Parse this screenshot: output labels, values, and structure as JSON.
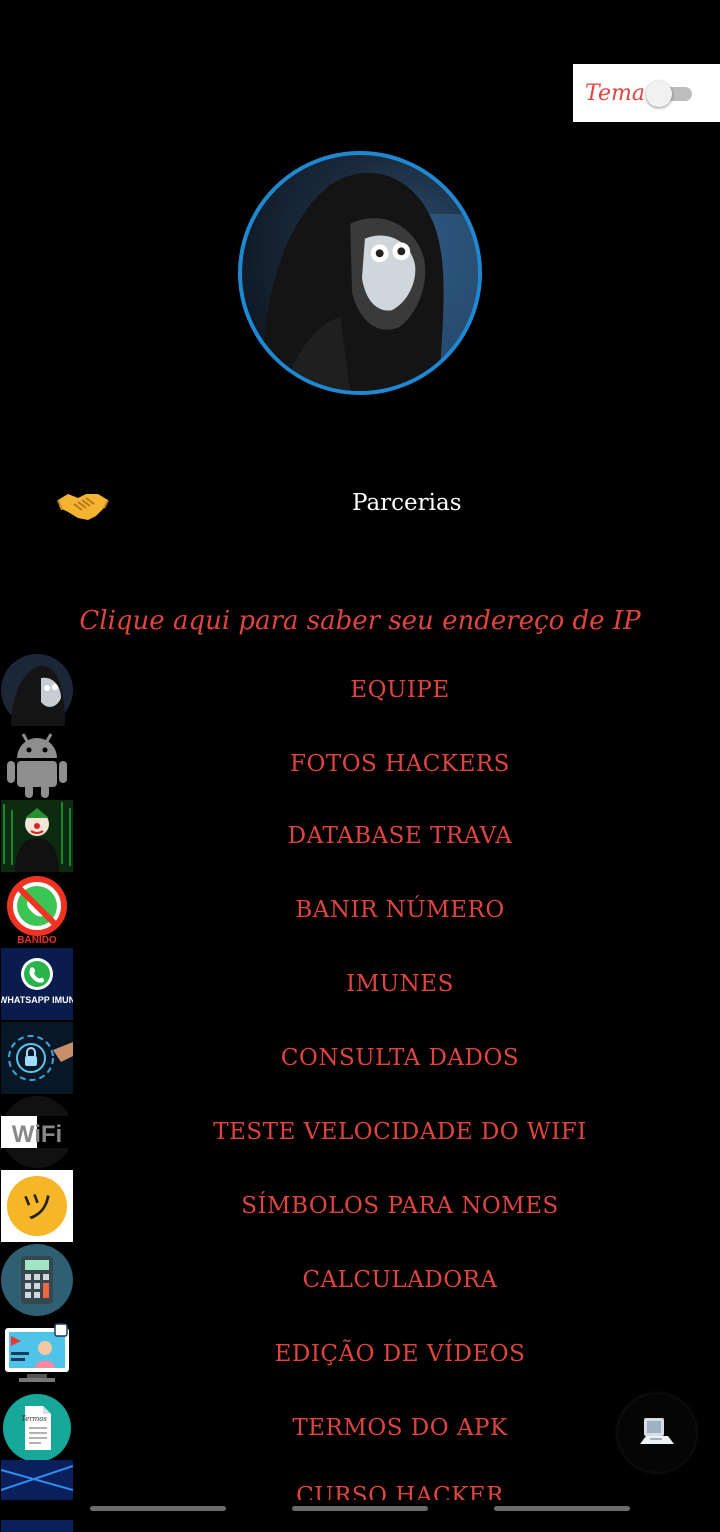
{
  "theme_toggle": {
    "label": "Tema",
    "enabled": false
  },
  "partners": {
    "label": "Parcerias"
  },
  "ip_link": {
    "label": "Clique aqui para saber seu endereço de IP"
  },
  "menu": [
    {
      "label": "EQUIPE",
      "icon": "hacker-icon"
    },
    {
      "label": "FOTOS HACKERS",
      "icon": "android-icon"
    },
    {
      "label": "DATABASE TRAVA",
      "icon": "joker-icon"
    },
    {
      "label": "BANIR NÚMERO",
      "icon": "whatsapp-banned-icon",
      "icon_caption": "BANIDO"
    },
    {
      "label": "IMUNES",
      "icon": "whatsapp-immune-icon",
      "icon_caption": "WHATSAPP IMUN"
    },
    {
      "label": "CONSULTA DADOS",
      "icon": "lock-touch-icon"
    },
    {
      "label": "TESTE VELOCIDADE DO WIFI",
      "icon": "wifi-icon",
      "icon_caption": "WiFi"
    },
    {
      "label": "SÍMBOLOS PARA NOMES",
      "icon": "smiley-symbol-icon",
      "icon_caption": "ツ"
    },
    {
      "label": "CALCULADORA",
      "icon": "calculator-icon"
    },
    {
      "label": "EDIÇÃO DE VÍDEOS",
      "icon": "video-editing-icon"
    },
    {
      "label": "TERMOS DO APK",
      "icon": "terms-document-icon",
      "icon_caption": "Termos"
    },
    {
      "label": "CURSO HACKER",
      "icon": "course-icon"
    }
  ],
  "colors": {
    "accent": "#e0443f",
    "background": "#000000",
    "avatar_ring": "#1e88d2"
  }
}
